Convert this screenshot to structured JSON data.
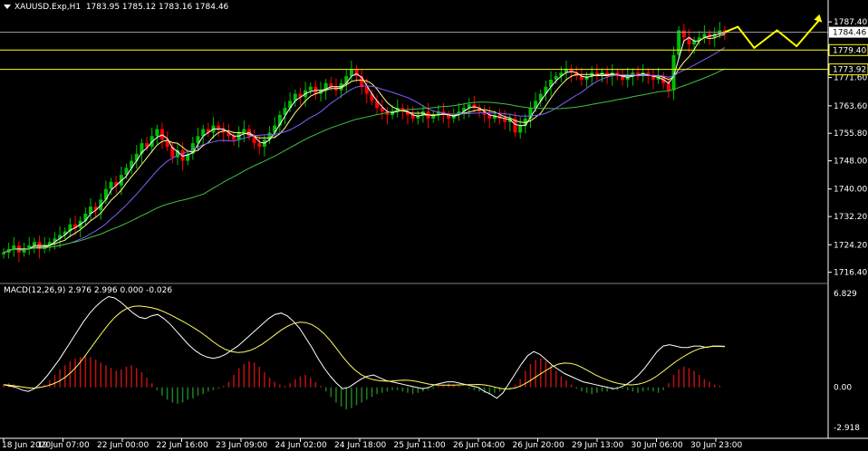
{
  "header": {
    "symbol": "XAUUSD.Exp,H1",
    "ohlc": "1783.95 1785.12 1783.16 1784.46"
  },
  "macd_header": {
    "label": "MACD(12,26,9) 2.976 2.996 0.000 -0.026"
  },
  "colors": {
    "background": "#000000",
    "bull": "#00c000",
    "bear": "#ff0000",
    "ma_fast": "#ffffff",
    "ma_mid": "#ffff80",
    "ma_slow": "#8060ff",
    "ma_long": "#40c040",
    "level_line": "#ffff00",
    "current_line": "#a0a0a0",
    "arrow": "#ffff00",
    "macd_pos": "#c01010",
    "macd_neg": "#208020",
    "macd_line": "#ffffff",
    "signal_line": "#ffff60"
  },
  "chart_data": [
    {
      "type": "candlestick",
      "title": "XAUUSD.Exp,H1",
      "ylim": [
        1714.0,
        1790.0
      ],
      "y_ticks": [
        "1787.40",
        "1779.40",
        "1771.60",
        "1763.60",
        "1755.80",
        "1748.00",
        "1740.00",
        "1732.20",
        "1724.20",
        "1716.40"
      ],
      "y_tick_values": [
        1787.4,
        1779.4,
        1771.6,
        1763.6,
        1755.8,
        1748.0,
        1740.0,
        1732.2,
        1724.2,
        1716.4
      ],
      "x_ticks": [
        "18 Jun 2020",
        "19 Jun 07:00",
        "22 Jun 00:00",
        "22 Jun 16:00",
        "23 Jun 09:00",
        "24 Jun 02:00",
        "24 Jun 18:00",
        "25 Jun 11:00",
        "26 Jun 04:00",
        "26 Jun 20:00",
        "29 Jun 13:00",
        "30 Jun 06:00",
        "30 Jun 23:00"
      ],
      "levels": [
        {
          "label": "1779.40",
          "value": 1779.4,
          "style": "yellow-box"
        },
        {
          "label": "1773.92",
          "value": 1773.92,
          "style": "yellow-box"
        },
        {
          "label": "1784.46",
          "value": 1784.46,
          "style": "current-price"
        }
      ],
      "closes": [
        1722,
        1723,
        1724,
        1722,
        1723,
        1724,
        1725,
        1723,
        1724,
        1725,
        1726,
        1727,
        1728,
        1730,
        1729,
        1731,
        1733,
        1735,
        1734,
        1737,
        1740,
        1742,
        1741,
        1744,
        1746,
        1748,
        1750,
        1753,
        1752,
        1755,
        1757,
        1754,
        1752,
        1749,
        1751,
        1748,
        1750,
        1753,
        1755,
        1757,
        1756,
        1758,
        1757,
        1756,
        1755,
        1754,
        1756,
        1757,
        1755,
        1753,
        1752,
        1754,
        1756,
        1758,
        1761,
        1763,
        1765,
        1767,
        1766,
        1768,
        1769,
        1767,
        1768,
        1770,
        1769,
        1768,
        1770,
        1772,
        1774,
        1772,
        1769,
        1767,
        1765,
        1763,
        1762,
        1761,
        1762,
        1763,
        1762,
        1761,
        1760,
        1761,
        1762,
        1760,
        1761,
        1762,
        1761,
        1760,
        1761,
        1762,
        1763,
        1764,
        1763,
        1762,
        1761,
        1760,
        1761,
        1760,
        1759,
        1760,
        1756,
        1758,
        1760,
        1763,
        1765,
        1767,
        1769,
        1771,
        1772,
        1773,
        1774,
        1773,
        1772,
        1771,
        1772,
        1773,
        1772,
        1773,
        1772,
        1773,
        1772,
        1771,
        1772,
        1773,
        1772,
        1773,
        1772,
        1771,
        1772,
        1770,
        1768,
        1778,
        1785,
        1783,
        1781,
        1782,
        1783,
        1784,
        1783,
        1784,
        1785,
        1784
      ],
      "arrow_path": [
        [
          0,
          1784.5
        ],
        [
          8,
          1786.0
        ],
        [
          18,
          1780.0
        ],
        [
          32,
          1785.0
        ],
        [
          44,
          1780.5
        ],
        [
          58,
          1788.0
        ]
      ],
      "ma_periods": "fast, mid, slow, long"
    },
    {
      "type": "bar",
      "title": "MACD(12,26,9)",
      "ylim": [
        -2.918,
        6.829
      ],
      "y_ticks": [
        "6.829",
        "0.00",
        "-2.918"
      ],
      "y_tick_values": [
        6.829,
        0.0,
        -2.918
      ],
      "histogram": [
        0.2,
        0.3,
        0.2,
        0.1,
        0.0,
        -0.1,
        0.0,
        0.1,
        0.2,
        0.5,
        0.9,
        1.3,
        1.6,
        1.9,
        2.1,
        2.2,
        2.3,
        2.2,
        2.0,
        1.8,
        1.6,
        1.4,
        1.2,
        1.3,
        1.5,
        1.6,
        1.4,
        1.1,
        0.7,
        0.3,
        -0.2,
        -0.6,
        -0.9,
        -1.1,
        -1.2,
        -1.1,
        -0.9,
        -0.8,
        -0.6,
        -0.5,
        -0.3,
        -0.2,
        -0.1,
        0.1,
        0.4,
        0.9,
        1.4,
        1.7,
        1.9,
        1.8,
        1.5,
        1.1,
        0.7,
        0.4,
        0.2,
        0.1,
        0.3,
        0.6,
        0.8,
        0.9,
        0.7,
        0.4,
        0.1,
        -0.3,
        -0.7,
        -1.1,
        -1.4,
        -1.6,
        -1.5,
        -1.3,
        -1.1,
        -0.9,
        -0.7,
        -0.5,
        -0.4,
        -0.3,
        -0.2,
        -0.2,
        -0.3,
        -0.4,
        -0.5,
        -0.4,
        -0.3,
        -0.2,
        -0.1,
        0.1,
        0.2,
        0.3,
        0.2,
        0.1,
        0.0,
        -0.1,
        -0.2,
        -0.3,
        -0.4,
        -0.5,
        -0.4,
        -0.3,
        -0.2,
        -0.1,
        0.2,
        0.6,
        1.2,
        1.7,
        2.0,
        2.1,
        1.9,
        1.6,
        1.2,
        0.8,
        0.5,
        0.2,
        -0.1,
        -0.3,
        -0.4,
        -0.5,
        -0.4,
        -0.3,
        -0.3,
        -0.2,
        -0.2,
        -0.1,
        -0.2,
        -0.3,
        -0.4,
        -0.3,
        -0.2,
        -0.3,
        -0.4,
        -0.2,
        0.3,
        0.9,
        1.3,
        1.5,
        1.4,
        1.2,
        0.9,
        0.6,
        0.4,
        0.2,
        0.1,
        0.0
      ],
      "macd_line": [
        0.2,
        0.1,
        0.0,
        -0.2,
        -0.3,
        -0.1,
        0.3,
        0.8,
        1.4,
        2.0,
        2.7,
        3.4,
        4.1,
        4.8,
        5.4,
        5.9,
        6.3,
        6.6,
        6.5,
        6.2,
        5.8,
        5.4,
        5.1,
        5.0,
        5.2,
        5.3,
        5.0,
        4.6,
        4.1,
        3.6,
        3.1,
        2.7,
        2.4,
        2.2,
        2.1,
        2.2,
        2.4,
        2.7,
        3.0,
        3.4,
        3.8,
        4.2,
        4.6,
        5.0,
        5.3,
        5.4,
        5.2,
        4.8,
        4.3,
        3.6,
        2.9,
        2.1,
        1.4,
        0.8,
        0.3,
        -0.1,
        0.0,
        0.3,
        0.6,
        0.8,
        0.9,
        0.7,
        0.5,
        0.4,
        0.3,
        0.2,
        0.1,
        0.0,
        -0.1,
        0.0,
        0.2,
        0.3,
        0.4,
        0.4,
        0.3,
        0.2,
        0.1,
        0.0,
        -0.3,
        -0.5,
        -0.8,
        -0.4,
        0.3,
        1.0,
        1.7,
        2.3,
        2.6,
        2.4,
        2.0,
        1.6,
        1.3,
        1.0,
        0.8,
        0.6,
        0.4,
        0.3,
        0.2,
        0.1,
        0.0,
        -0.1,
        0.0,
        0.2,
        0.5,
        0.9,
        1.4,
        2.0,
        2.6,
        3.0,
        3.1,
        3.0,
        2.9,
        2.9,
        3.0,
        3.0,
        2.9,
        3.0,
        3.0,
        2.98
      ]
    }
  ]
}
